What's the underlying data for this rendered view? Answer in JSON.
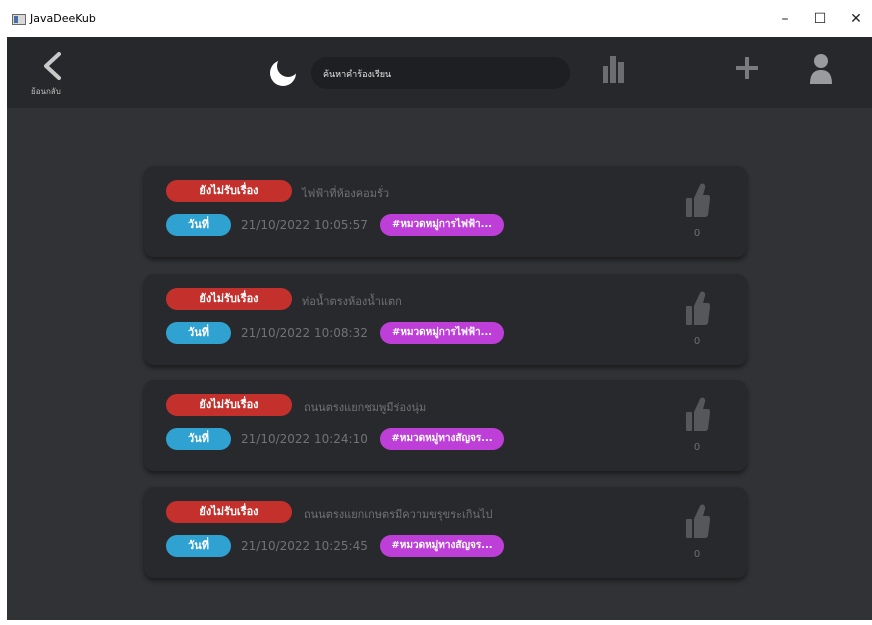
{
  "window": {
    "title": "JavaDeeKub",
    "minimize": "–",
    "maximize": "☐",
    "close": "✕"
  },
  "appbar": {
    "back_label": "ย้อนกลับ",
    "search_text": "ค้นหาคำร้องเรียน",
    "icons": [
      "back-arrow-icon",
      "moon-icon",
      "bar-chart-icon",
      "plus-icon",
      "user-icon"
    ]
  },
  "colors": {
    "status": "#c4302b",
    "date_pill": "#2fa2d1",
    "category": "#bd3fd8",
    "card": "#28292c",
    "background": "#313235"
  },
  "cards": [
    {
      "status": "ยังไม่รับเรื่อง",
      "title": "ไฟฟ้าที่ห้องคอมรั่ว",
      "date_label": "วันที่",
      "date": "21/10/2022 10:05:57",
      "category": "#หมวดหมู่การไฟฟ้า...",
      "likes": "0"
    },
    {
      "status": "ยังไม่รับเรื่อง",
      "title": "ท่อน้ำตรงห้องน้ำแตก",
      "date_label": "วันที่",
      "date": "21/10/2022 10:08:32",
      "category": "#หมวดหมู่การไฟฟ้า...",
      "likes": "0"
    },
    {
      "status": "ยังไม่รับเรื่อง",
      "title": "ถนนตรงแยกชมพูมีร่องนุ่ม",
      "date_label": "วันที่",
      "date": "21/10/2022 10:24:10",
      "category": "#หมวดหมู่ทางสัญจร...",
      "likes": "0"
    },
    {
      "status": "ยังไม่รับเรื่อง",
      "title": "ถนนตรงแยกเกษตรมีความขรุขระเกินไป",
      "date_label": "วันที่",
      "date": "21/10/2022 10:25:45",
      "category": "#หมวดหมู่ทางสัญจร...",
      "likes": "0"
    }
  ]
}
